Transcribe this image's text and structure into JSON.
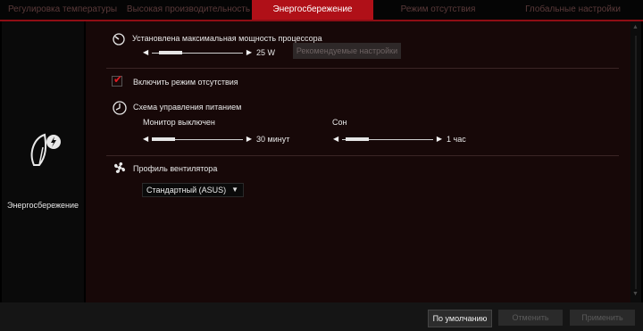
{
  "tabs": [
    {
      "label": "Регулировка температуры",
      "active": false
    },
    {
      "label": "Высокая производительность",
      "active": false
    },
    {
      "label": "Энергосбережение",
      "active": true
    },
    {
      "label": "Режим отсутствия",
      "active": false
    },
    {
      "label": "Глобальные настройки",
      "active": false
    }
  ],
  "sidebar": {
    "label": "Энергосбережение",
    "icon": "leaf-power-icon"
  },
  "power": {
    "label": "Установлена максимальная мощность процессора",
    "value": "25 W",
    "slider_level": 0.1,
    "recommended_button": "Рекомендуемые настройки",
    "icon": "gauge-icon"
  },
  "away": {
    "label": "Включить режим отсутствия",
    "checked": true
  },
  "power_plan": {
    "label": "Схема управления питанием",
    "icon": "clock-icon",
    "monitor_label": "Монитор выключен",
    "monitor_value": "30 минут",
    "monitor_level": 0.0,
    "sleep_label": "Сон",
    "sleep_value": "1 час",
    "sleep_level": 0.05
  },
  "fan": {
    "label": "Профиль вентилятора",
    "icon": "fan-icon",
    "selected": "Стандартный (ASUS)"
  },
  "footer": {
    "default_button": "По умолчанию",
    "cancel_button": "Отменить",
    "apply_button": "Применить"
  },
  "colors": {
    "accent": "#b01018",
    "background": "#170808"
  }
}
